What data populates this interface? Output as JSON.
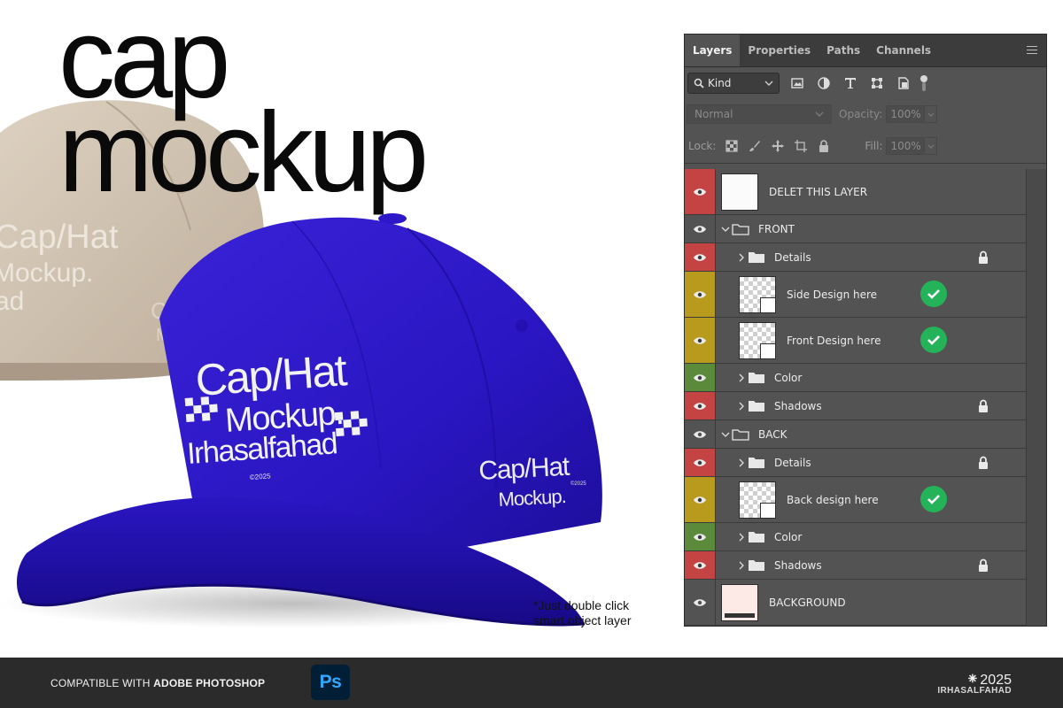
{
  "hero": {
    "line1": "cap",
    "line2": "mockup"
  },
  "cap_front": {
    "main_line1": "Cap/Hat",
    "main_line2": "Mockup.",
    "main_line3": "Irhasalfahad",
    "main_small": "©2025",
    "side_line1": "Cap/Hat",
    "side_line2": "Mockup.",
    "side_small": "©2025",
    "color": "#2a16c2"
  },
  "cap_back": {
    "line1": "Cap/Hat",
    "line2": "Mockup.",
    "line3": "ad",
    "side1": "Cap",
    "side2": "M",
    "color": "#d3c6b5"
  },
  "note": {
    "line1": "*Just double click",
    "line2": "smart object layer"
  },
  "panel": {
    "tabs": [
      "Layers",
      "Properties",
      "Paths",
      "Channels"
    ],
    "kind": "Kind",
    "blend_mode": "Normal",
    "opacity_label": "Opacity:",
    "opacity_value": "100%",
    "lock_label": "Lock:",
    "fill_label": "Fill:",
    "fill_value": "100%",
    "layers": [
      {
        "name": "DELET THIS LAYER",
        "color": "red"
      },
      {
        "name": "FRONT",
        "color": "none"
      },
      {
        "name": "Details",
        "color": "red",
        "locked": true
      },
      {
        "name": "Side Design here",
        "color": "yellow",
        "check": true
      },
      {
        "name": "Front Design here",
        "color": "yellow",
        "check": true
      },
      {
        "name": "Color",
        "color": "green"
      },
      {
        "name": "Shadows",
        "color": "red",
        "locked": true
      },
      {
        "name": "BACK",
        "color": "none"
      },
      {
        "name": "Details",
        "color": "red",
        "locked": true
      },
      {
        "name": "Back design here",
        "color": "yellow",
        "check": true
      },
      {
        "name": "Color",
        "color": "green"
      },
      {
        "name": "Shadows",
        "color": "red",
        "locked": true
      },
      {
        "name": "BACKGROUND",
        "color": "none"
      }
    ]
  },
  "footer": {
    "compat_prefix": "COMPATIBLE WITH",
    "compat_product": "ADOBE PHOTOSHOP",
    "ps_badge": "Ps",
    "year_symbol": "⁕",
    "year": "2025",
    "signature": "IRHASALFAHAD"
  },
  "colors": {
    "footer_bg": "#2b2b2b",
    "label_red": "#c44343",
    "label_yellow": "#b89a1c",
    "label_green": "#5b8a3a",
    "check_green": "#25b35a",
    "ps_blue": "#31a8ff"
  },
  "icons": [
    "search-icon",
    "chevron-down-icon",
    "image-filter-icon",
    "adjustment-filter-icon",
    "type-filter-icon",
    "shape-filter-icon",
    "smart-object-filter-icon",
    "filter-toggle-icon",
    "panel-menu-icon",
    "lock-pixels-icon",
    "lock-brush-icon",
    "lock-move-icon",
    "lock-artboard-icon",
    "lock-all-icon",
    "eye-icon",
    "folder-icon",
    "chevron-right-icon",
    "lock-icon",
    "check-icon"
  ]
}
